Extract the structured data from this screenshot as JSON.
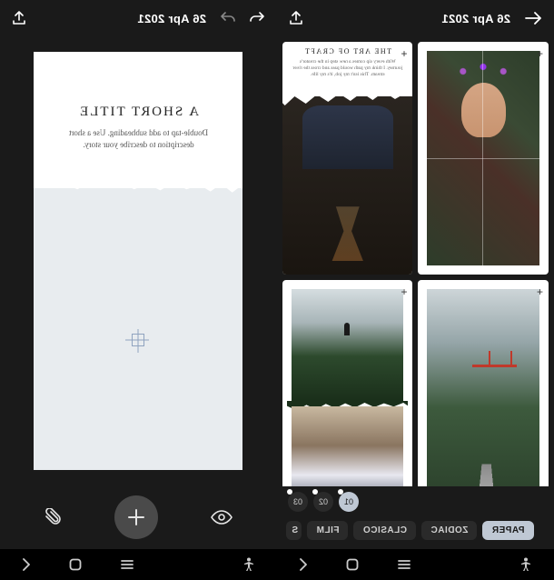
{
  "left": {
    "date": "26 Apr 2021",
    "title": "A SHORT TITLE",
    "subtitle": "Double-tap to add subheading. Use a short description to describe your story."
  },
  "right": {
    "date": "26 Apr 2021",
    "templates": {
      "card2_title": "THE ART OF CRAFT",
      "card2_body": "With every sip comes a new step in the creator's journey. I think my path would pass and cross the river stream. This isn't my job, it's my life."
    },
    "pagination": [
      "01",
      "02",
      "03"
    ],
    "categories": [
      "PAPER",
      "ZODIAC",
      "CLASICO",
      "FILM",
      "S"
    ]
  }
}
